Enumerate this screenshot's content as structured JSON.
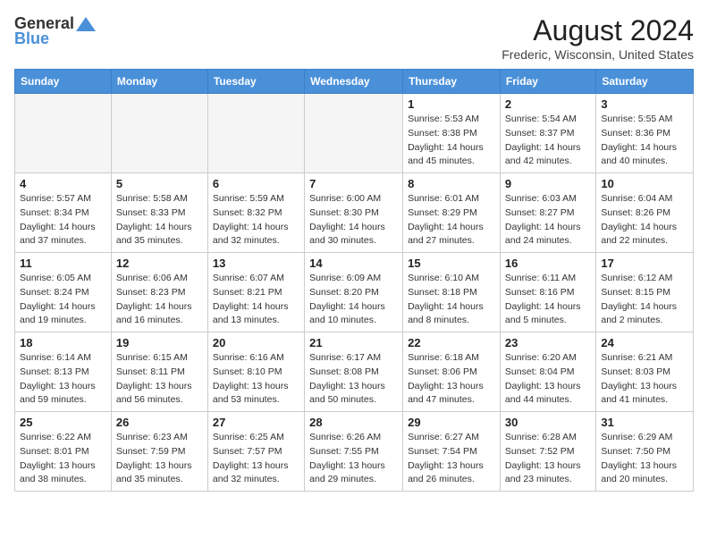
{
  "header": {
    "logo_general": "General",
    "logo_blue": "Blue",
    "month_year": "August 2024",
    "location": "Frederic, Wisconsin, United States"
  },
  "weekdays": [
    "Sunday",
    "Monday",
    "Tuesday",
    "Wednesday",
    "Thursday",
    "Friday",
    "Saturday"
  ],
  "weeks": [
    [
      {
        "day": "",
        "detail": ""
      },
      {
        "day": "",
        "detail": ""
      },
      {
        "day": "",
        "detail": ""
      },
      {
        "day": "",
        "detail": ""
      },
      {
        "day": "1",
        "detail": "Sunrise: 5:53 AM\nSunset: 8:38 PM\nDaylight: 14 hours\nand 45 minutes."
      },
      {
        "day": "2",
        "detail": "Sunrise: 5:54 AM\nSunset: 8:37 PM\nDaylight: 14 hours\nand 42 minutes."
      },
      {
        "day": "3",
        "detail": "Sunrise: 5:55 AM\nSunset: 8:36 PM\nDaylight: 14 hours\nand 40 minutes."
      }
    ],
    [
      {
        "day": "4",
        "detail": "Sunrise: 5:57 AM\nSunset: 8:34 PM\nDaylight: 14 hours\nand 37 minutes."
      },
      {
        "day": "5",
        "detail": "Sunrise: 5:58 AM\nSunset: 8:33 PM\nDaylight: 14 hours\nand 35 minutes."
      },
      {
        "day": "6",
        "detail": "Sunrise: 5:59 AM\nSunset: 8:32 PM\nDaylight: 14 hours\nand 32 minutes."
      },
      {
        "day": "7",
        "detail": "Sunrise: 6:00 AM\nSunset: 8:30 PM\nDaylight: 14 hours\nand 30 minutes."
      },
      {
        "day": "8",
        "detail": "Sunrise: 6:01 AM\nSunset: 8:29 PM\nDaylight: 14 hours\nand 27 minutes."
      },
      {
        "day": "9",
        "detail": "Sunrise: 6:03 AM\nSunset: 8:27 PM\nDaylight: 14 hours\nand 24 minutes."
      },
      {
        "day": "10",
        "detail": "Sunrise: 6:04 AM\nSunset: 8:26 PM\nDaylight: 14 hours\nand 22 minutes."
      }
    ],
    [
      {
        "day": "11",
        "detail": "Sunrise: 6:05 AM\nSunset: 8:24 PM\nDaylight: 14 hours\nand 19 minutes."
      },
      {
        "day": "12",
        "detail": "Sunrise: 6:06 AM\nSunset: 8:23 PM\nDaylight: 14 hours\nand 16 minutes."
      },
      {
        "day": "13",
        "detail": "Sunrise: 6:07 AM\nSunset: 8:21 PM\nDaylight: 14 hours\nand 13 minutes."
      },
      {
        "day": "14",
        "detail": "Sunrise: 6:09 AM\nSunset: 8:20 PM\nDaylight: 14 hours\nand 10 minutes."
      },
      {
        "day": "15",
        "detail": "Sunrise: 6:10 AM\nSunset: 8:18 PM\nDaylight: 14 hours\nand 8 minutes."
      },
      {
        "day": "16",
        "detail": "Sunrise: 6:11 AM\nSunset: 8:16 PM\nDaylight: 14 hours\nand 5 minutes."
      },
      {
        "day": "17",
        "detail": "Sunrise: 6:12 AM\nSunset: 8:15 PM\nDaylight: 14 hours\nand 2 minutes."
      }
    ],
    [
      {
        "day": "18",
        "detail": "Sunrise: 6:14 AM\nSunset: 8:13 PM\nDaylight: 13 hours\nand 59 minutes."
      },
      {
        "day": "19",
        "detail": "Sunrise: 6:15 AM\nSunset: 8:11 PM\nDaylight: 13 hours\nand 56 minutes."
      },
      {
        "day": "20",
        "detail": "Sunrise: 6:16 AM\nSunset: 8:10 PM\nDaylight: 13 hours\nand 53 minutes."
      },
      {
        "day": "21",
        "detail": "Sunrise: 6:17 AM\nSunset: 8:08 PM\nDaylight: 13 hours\nand 50 minutes."
      },
      {
        "day": "22",
        "detail": "Sunrise: 6:18 AM\nSunset: 8:06 PM\nDaylight: 13 hours\nand 47 minutes."
      },
      {
        "day": "23",
        "detail": "Sunrise: 6:20 AM\nSunset: 8:04 PM\nDaylight: 13 hours\nand 44 minutes."
      },
      {
        "day": "24",
        "detail": "Sunrise: 6:21 AM\nSunset: 8:03 PM\nDaylight: 13 hours\nand 41 minutes."
      }
    ],
    [
      {
        "day": "25",
        "detail": "Sunrise: 6:22 AM\nSunset: 8:01 PM\nDaylight: 13 hours\nand 38 minutes."
      },
      {
        "day": "26",
        "detail": "Sunrise: 6:23 AM\nSunset: 7:59 PM\nDaylight: 13 hours\nand 35 minutes."
      },
      {
        "day": "27",
        "detail": "Sunrise: 6:25 AM\nSunset: 7:57 PM\nDaylight: 13 hours\nand 32 minutes."
      },
      {
        "day": "28",
        "detail": "Sunrise: 6:26 AM\nSunset: 7:55 PM\nDaylight: 13 hours\nand 29 minutes."
      },
      {
        "day": "29",
        "detail": "Sunrise: 6:27 AM\nSunset: 7:54 PM\nDaylight: 13 hours\nand 26 minutes."
      },
      {
        "day": "30",
        "detail": "Sunrise: 6:28 AM\nSunset: 7:52 PM\nDaylight: 13 hours\nand 23 minutes."
      },
      {
        "day": "31",
        "detail": "Sunrise: 6:29 AM\nSunset: 7:50 PM\nDaylight: 13 hours\nand 20 minutes."
      }
    ]
  ]
}
